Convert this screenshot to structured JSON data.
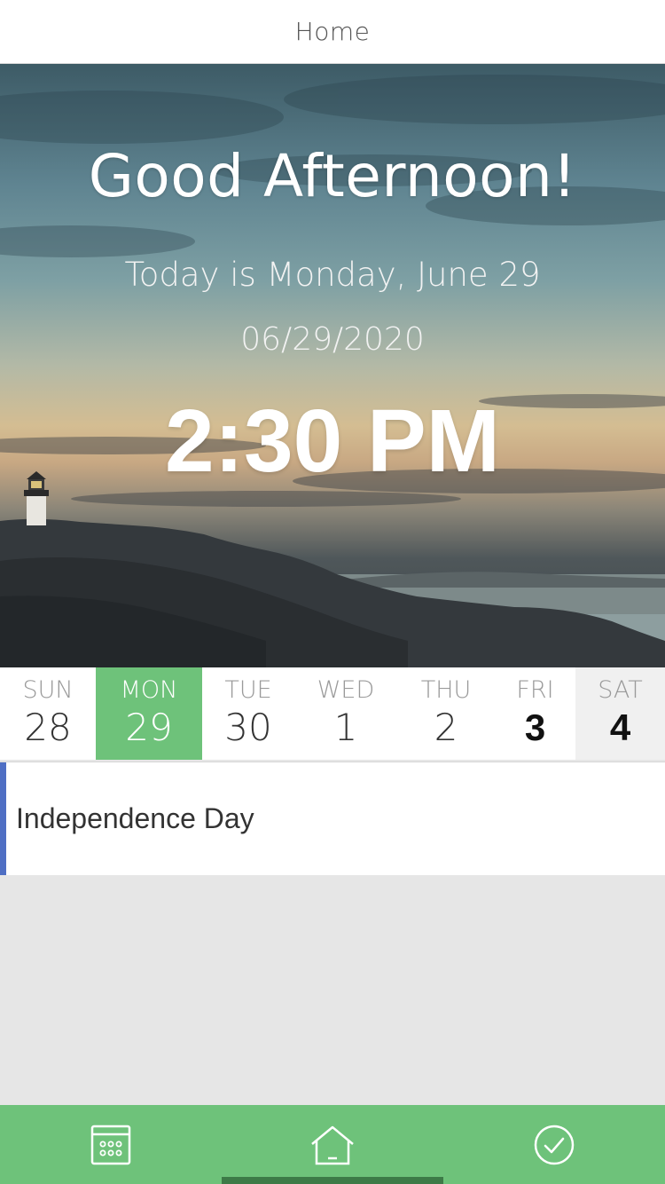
{
  "header": {
    "title": "Home"
  },
  "hero": {
    "greeting": "Good Afternoon!",
    "today": "Today is Monday, June 29",
    "date": "06/29/2020",
    "time": "2:30 PM"
  },
  "week": {
    "days": [
      {
        "name": "SUN",
        "num": "28"
      },
      {
        "name": "MON",
        "num": "29"
      },
      {
        "name": "TUE",
        "num": "30"
      },
      {
        "name": "WED",
        "num": "1"
      },
      {
        "name": "THU",
        "num": "2"
      },
      {
        "name": "FRI",
        "num": "3"
      },
      {
        "name": "SAT",
        "num": "4"
      }
    ],
    "selected_color": "#6ec27a"
  },
  "event": {
    "label": "Independence Day",
    "accent": "#4f6fc4"
  },
  "tabbar": {
    "color": "#6ec27a",
    "tabs": [
      {
        "icon": "calendar-icon"
      },
      {
        "icon": "home-icon",
        "active": true
      },
      {
        "icon": "checkmark-circle-icon"
      }
    ]
  }
}
